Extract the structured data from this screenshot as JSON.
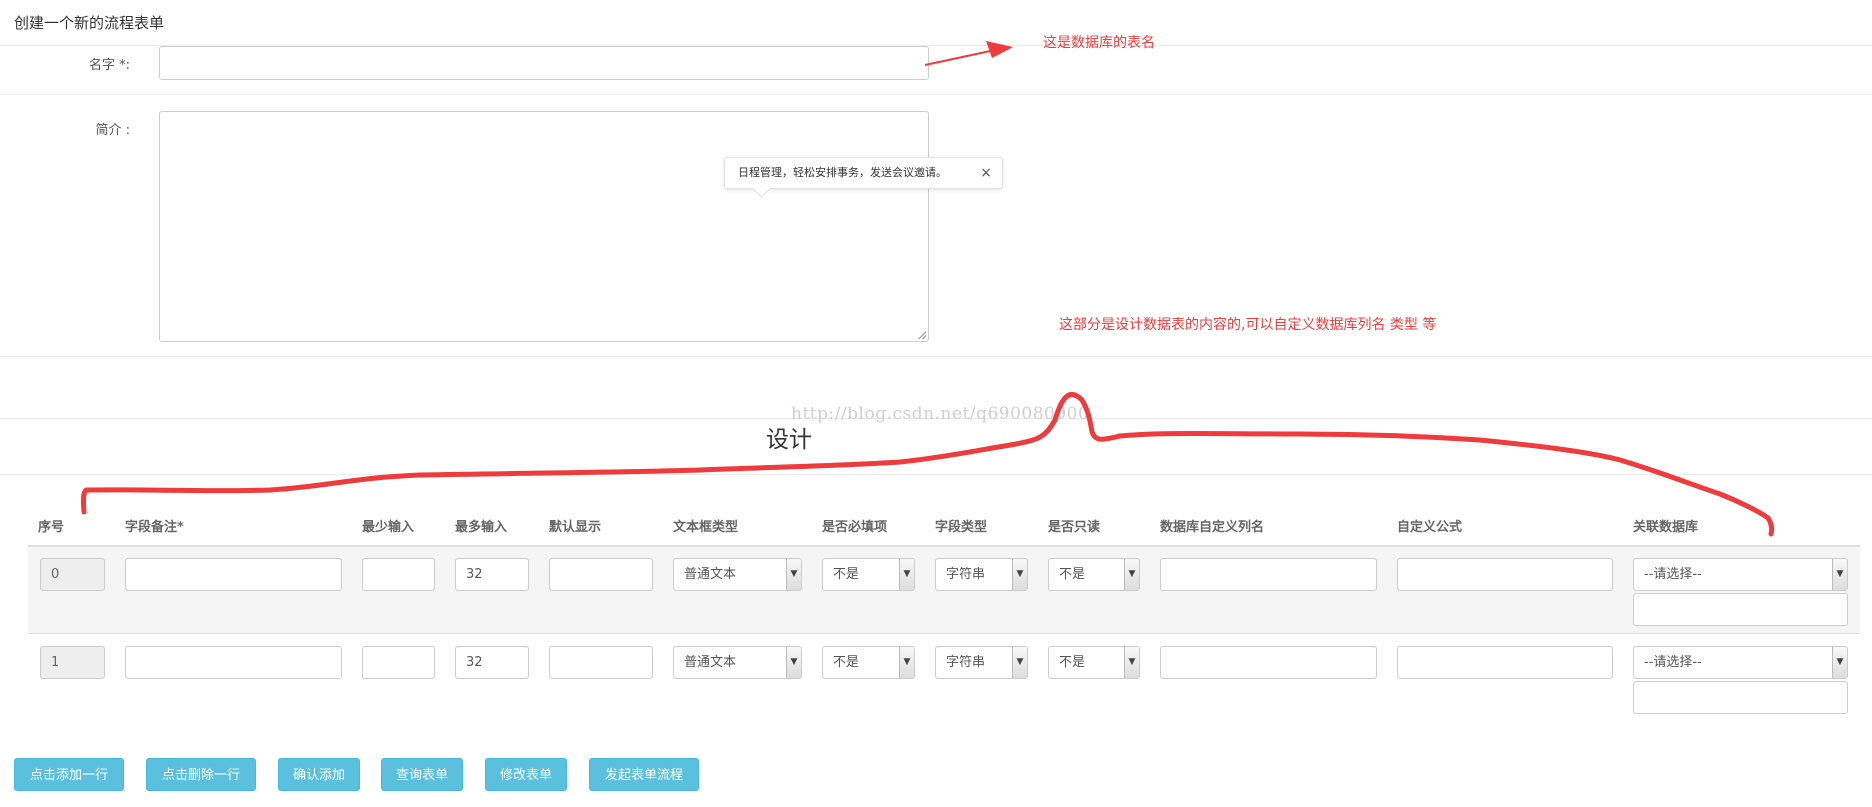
{
  "page": {
    "title": "创建一个新的流程表单"
  },
  "form": {
    "name_label": "名字 *:",
    "name_value": "",
    "intro_label": "简介 :",
    "intro_value": ""
  },
  "tooltip": {
    "text": "日程管理，轻松安排事务，发送会议邀请。",
    "close_icon": "×"
  },
  "annotations": {
    "table_name_note": "这是数据库的表名",
    "design_note": "这部分是设计数据表的内容的,可以自定义数据库列名 类型 等",
    "color": "#ef3b3b"
  },
  "watermark": "http://blog.csdn.net/q690080900",
  "design": {
    "title": "设计",
    "columns": [
      "序号",
      "字段备注*",
      "最少输入",
      "最多输入",
      "默认显示",
      "文本框类型",
      "是否必填项",
      "字段类型",
      "是否只读",
      "数据库自定义列名",
      "自定义公式",
      "关联数据库"
    ],
    "rows": [
      {
        "index": "0",
        "remark": "",
        "min": "",
        "max": "32",
        "default": "",
        "textbox_type": "普通文本",
        "required": "不是",
        "field_type": "字符串",
        "readonly": "不是",
        "db_column": "",
        "formula": "",
        "related_db": "--请选择--",
        "related_extra": ""
      },
      {
        "index": "1",
        "remark": "",
        "min": "",
        "max": "32",
        "default": "",
        "textbox_type": "普通文本",
        "required": "不是",
        "field_type": "字符串",
        "readonly": "不是",
        "db_column": "",
        "formula": "",
        "related_db": "--请选择--",
        "related_extra": ""
      }
    ]
  },
  "buttons": {
    "add_row": "点击添加一行",
    "delete_row": "点击删除一行",
    "confirm_add": "确认添加",
    "query_form": "查询表单",
    "edit_form": "修改表单",
    "start_flow": "发起表单流程",
    "color": "#5bc0de"
  }
}
